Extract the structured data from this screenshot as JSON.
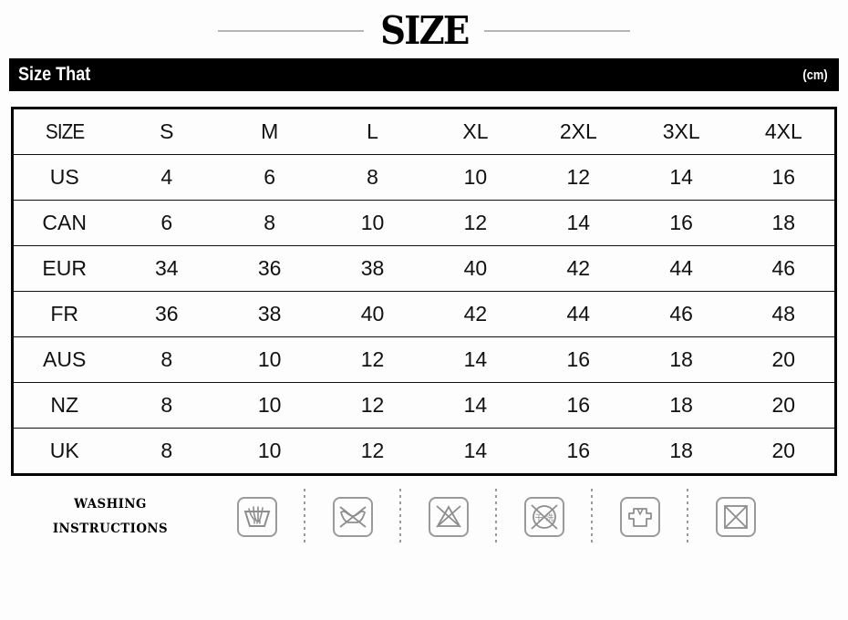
{
  "title": {
    "text": "SIZE"
  },
  "banner": {
    "label": "Size That",
    "unit": "(cm)"
  },
  "table": {
    "corner_label": "SIZE",
    "columns": [
      "S",
      "M",
      "L",
      "XL",
      "2XL",
      "3XL",
      "4XL"
    ],
    "rows": [
      {
        "label": "US",
        "values": [
          "4",
          "6",
          "8",
          "10",
          "12",
          "14",
          "16"
        ]
      },
      {
        "label": "CAN",
        "values": [
          "6",
          "8",
          "10",
          "12",
          "14",
          "16",
          "18"
        ]
      },
      {
        "label": "EUR",
        "values": [
          "34",
          "36",
          "38",
          "40",
          "42",
          "44",
          "46"
        ]
      },
      {
        "label": "FR",
        "values": [
          "36",
          "38",
          "40",
          "42",
          "44",
          "46",
          "48"
        ]
      },
      {
        "label": "AUS",
        "values": [
          "8",
          "10",
          "12",
          "14",
          "16",
          "18",
          "20"
        ]
      },
      {
        "label": "NZ",
        "values": [
          "8",
          "10",
          "12",
          "14",
          "16",
          "18",
          "20"
        ]
      },
      {
        "label": "UK",
        "values": [
          "8",
          "10",
          "12",
          "14",
          "16",
          "18",
          "20"
        ]
      }
    ]
  },
  "care": {
    "heading_line1": "WASHING",
    "heading_line2": "INSTRUCTIONS",
    "icons": [
      {
        "name": "hand-wash-icon"
      },
      {
        "name": "do-not-wring-icon"
      },
      {
        "name": "do-not-bleach-icon"
      },
      {
        "name": "do-not-dry-clean-icon",
        "inner_text": "干洗"
      },
      {
        "name": "dry-flat-icon"
      },
      {
        "name": "do-not-tumble-dry-icon"
      }
    ]
  },
  "colors": {
    "background": "#fdfdfd",
    "banner": "#000000",
    "text": "#111111",
    "rule": "#b5b5b5",
    "icon_stroke": "#9a9a9a"
  }
}
